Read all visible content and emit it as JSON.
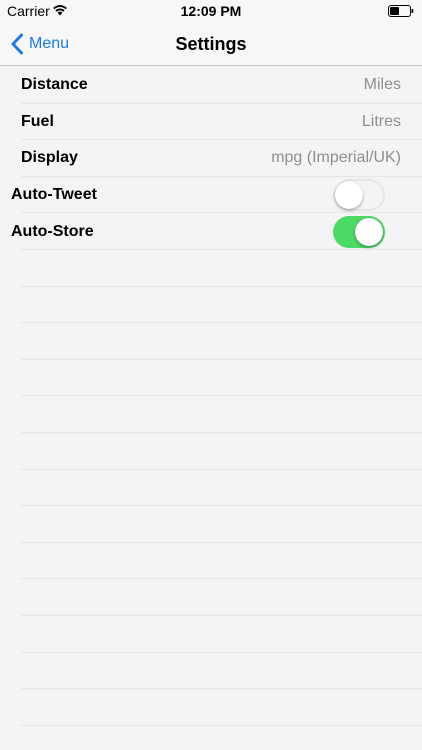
{
  "status_bar": {
    "carrier": "Carrier",
    "time": "12:09 PM",
    "wifi_icon": "wifi-icon",
    "battery_icon": "battery-icon"
  },
  "nav_bar": {
    "back_label": "Menu",
    "title": "Settings",
    "accent_color": "#1a7ae8"
  },
  "settings": {
    "distance": {
      "label": "Distance",
      "value": "Miles"
    },
    "fuel": {
      "label": "Fuel",
      "value": "Litres"
    },
    "display": {
      "label": "Display",
      "value": "mpg (Imperial/UK)"
    },
    "auto_tweet": {
      "label": "Auto-Tweet",
      "enabled": false
    },
    "auto_store": {
      "label": "Auto-Store",
      "enabled": true,
      "on_color": "#4cd964"
    }
  }
}
